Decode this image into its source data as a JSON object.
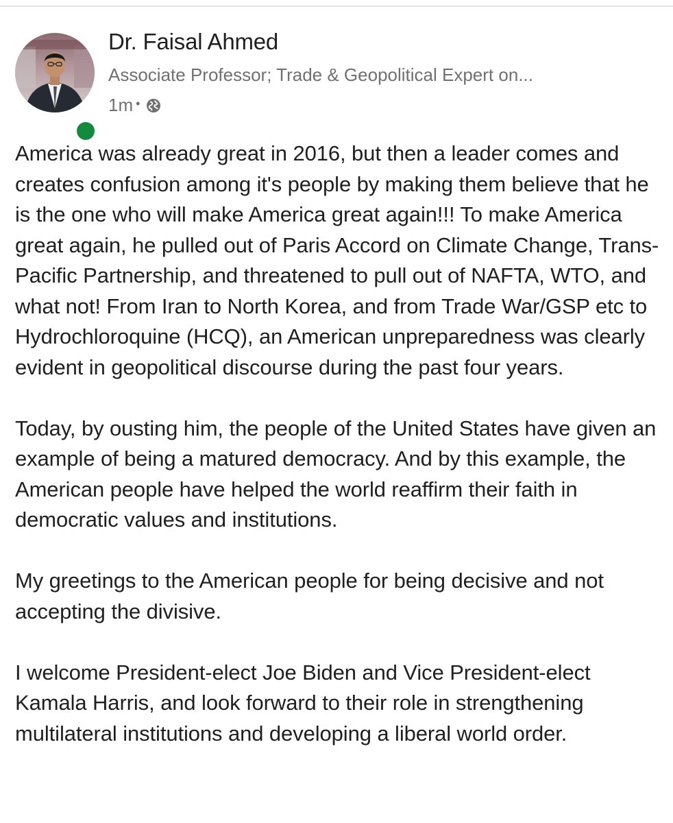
{
  "post": {
    "author": {
      "name": "Dr. Faisal Ahmed",
      "headline": "Associate Professor; Trade & Geopolitical Expert on...",
      "presence_color": "#148a3e"
    },
    "meta": {
      "time": "1m",
      "separator": "•",
      "visibility_icon": "globe-icon"
    },
    "paragraphs": [
      "America was already great in 2016, but then a leader comes and creates confusion among it's people by making them believe that he is the one who will make America great again!!! To make America great again, he pulled out of Paris Accord on Climate Change, Trans-Pacific Partnership, and threatened to pull out of NAFTA, WTO, and what not! From Iran to North Korea, and from Trade War/GSP etc to Hydrochloroquine (HCQ), an American unpreparedness was clearly evident in geopolitical discourse during the past four years.",
      "Today, by ousting him, the people of the United States have given an example of being a matured democracy. And by this example, the American people have helped the world reaffirm their faith in democratic values and institutions.",
      "My greetings to the American people for being decisive and not accepting the divisive.",
      "I welcome President-elect Joe Biden and Vice President-elect Kamala Harris, and look forward to their role in strengthening multilateral institutions and developing a liberal world order."
    ]
  }
}
